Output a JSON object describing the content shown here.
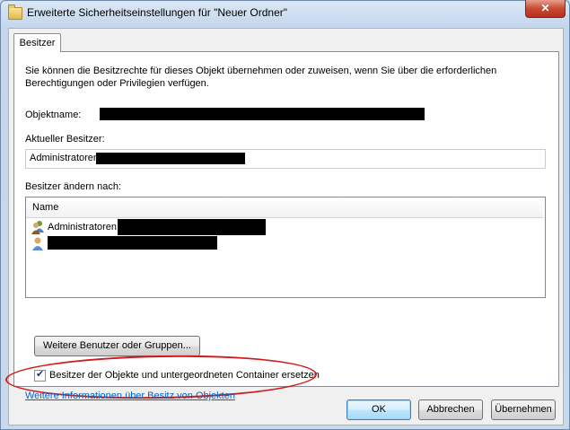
{
  "window": {
    "title": "Erweiterte Sicherheitseinstellungen für \"Neuer Ordner\"",
    "close_glyph": "✕"
  },
  "tabs": [
    {
      "label": "Besitzer",
      "active": true
    }
  ],
  "description": "Sie können die Besitzrechte für dieses Objekt übernehmen oder zuweisen, wenn Sie über die erforderlichen Berechtigungen oder Privilegien verfügen.",
  "object_name": {
    "label": "Objektname:"
  },
  "current_owner": {
    "label": "Aktueller Besitzer:",
    "value": "Administratoren"
  },
  "change_owner": {
    "label": "Besitzer ändern nach:",
    "column_header": "Name",
    "rows": [
      {
        "name": "Administratoren",
        "icon": "group-users-icon"
      },
      {
        "name": "",
        "icon": "user-icon"
      }
    ]
  },
  "more_users_button": "Weitere Benutzer oder Gruppen...",
  "replace_owner_checkbox": {
    "label": "Besitzer der Objekte und untergeordneten Container ersetzen",
    "checked": true
  },
  "info_link": "Weitere Informationen über Besitz von Objekten",
  "buttons": {
    "ok": "OK",
    "cancel": "Abbrechen",
    "apply": "Übernehmen"
  },
  "colors": {
    "annotation_ellipse": "#d11a1a",
    "link": "#0066cc"
  }
}
